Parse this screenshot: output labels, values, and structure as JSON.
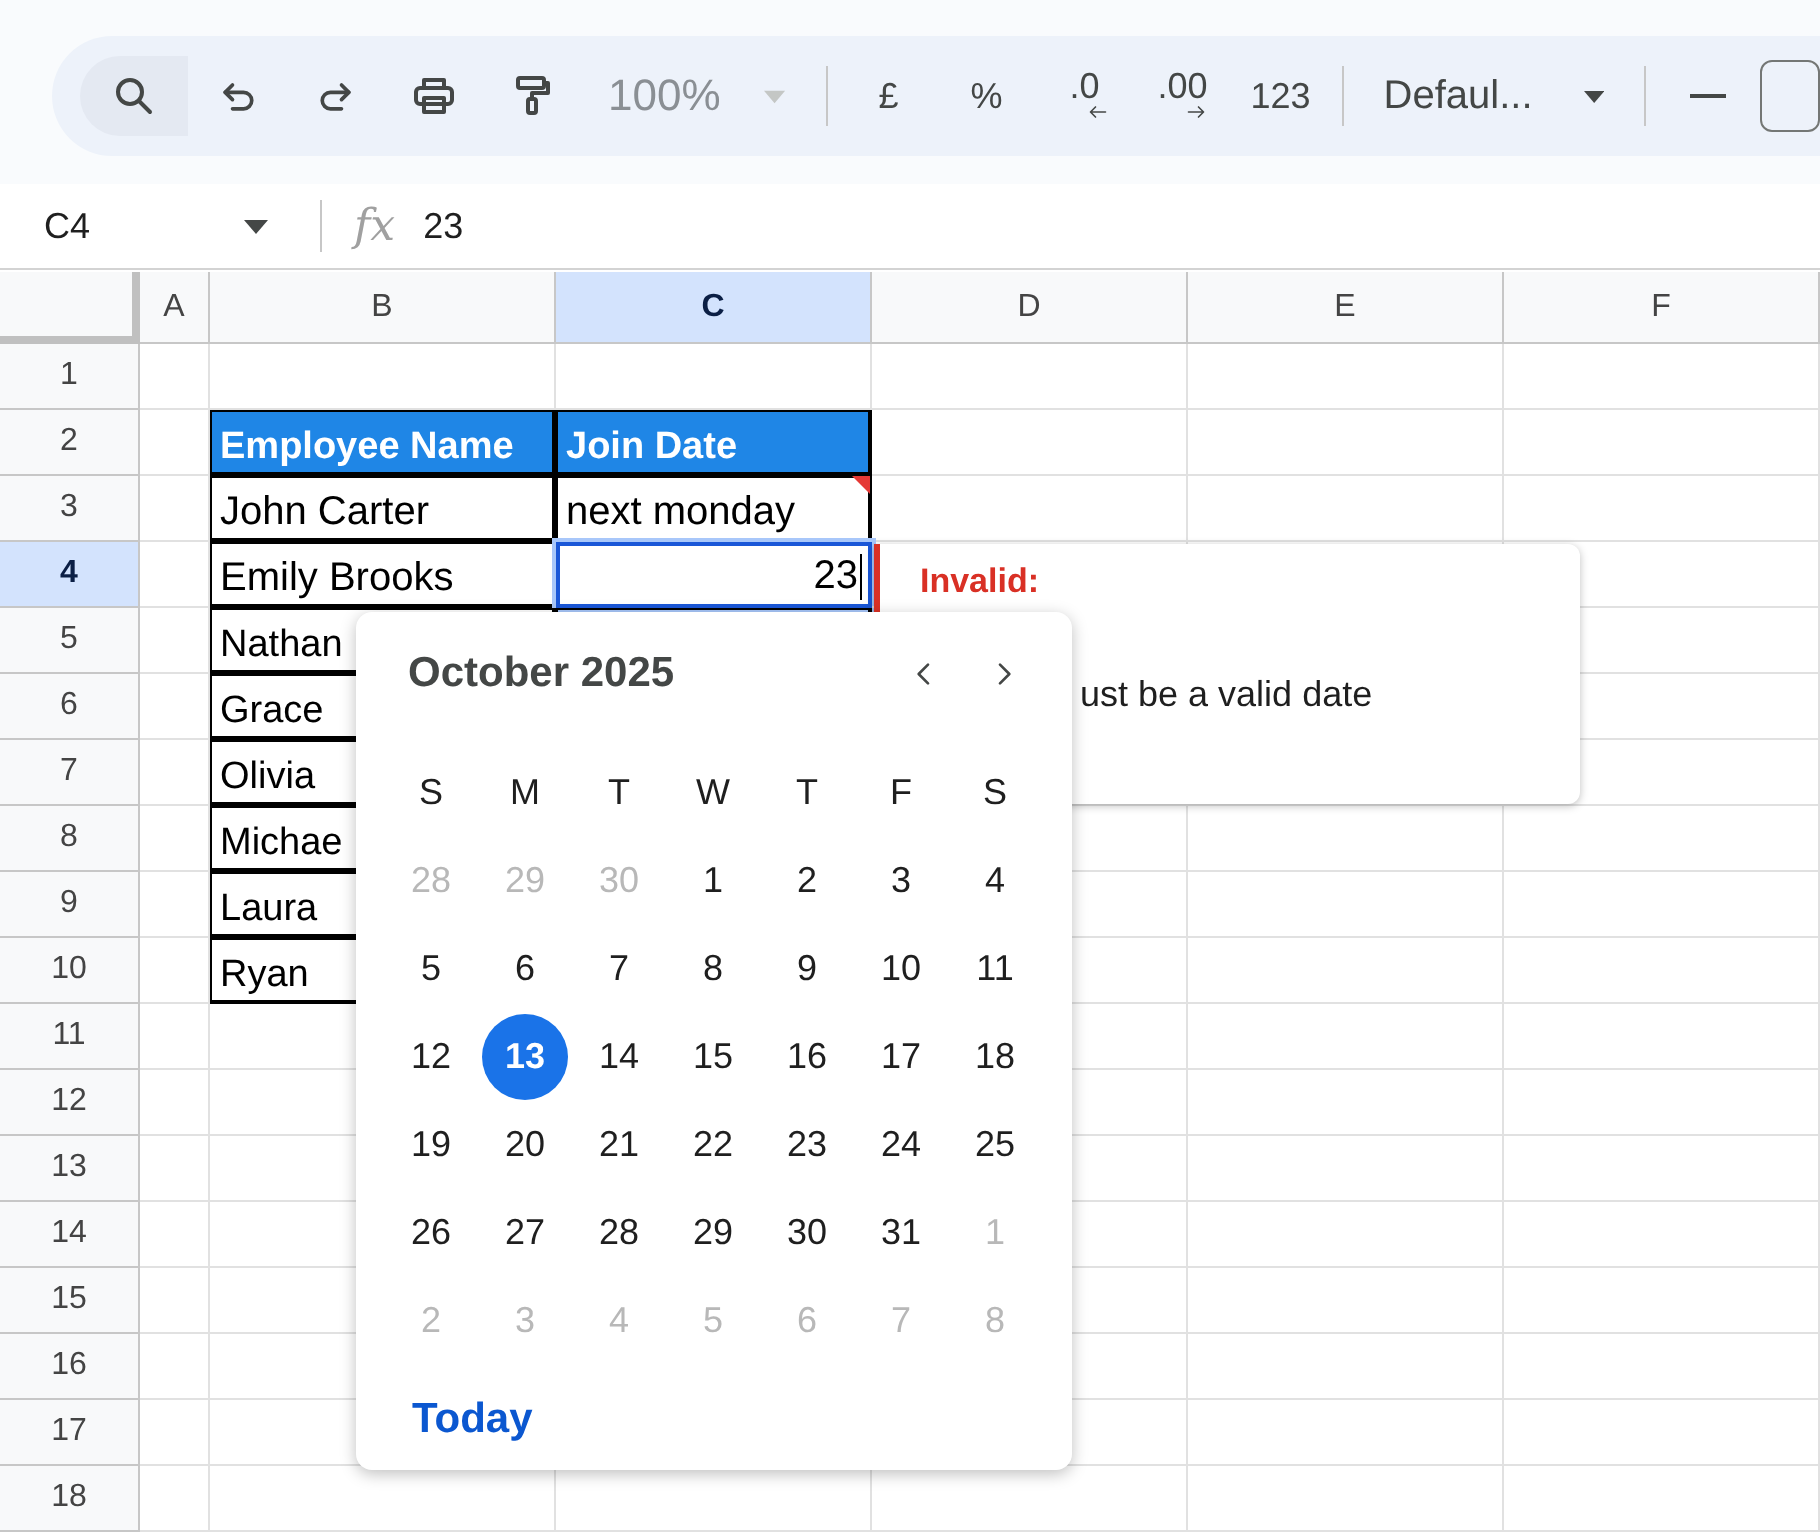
{
  "toolbar": {
    "items": [
      {
        "kind": "search"
      },
      {
        "kind": "undo"
      },
      {
        "kind": "redo"
      },
      {
        "kind": "print"
      },
      {
        "kind": "paint_format"
      },
      {
        "kind": "zoom",
        "label": "100%",
        "disabled": true
      },
      {
        "kind": "divider"
      },
      {
        "kind": "text",
        "label": "£"
      },
      {
        "kind": "text",
        "label": "%"
      },
      {
        "kind": "decimal_decrease",
        "label": ".0"
      },
      {
        "kind": "decimal_increase",
        "label": ".00"
      },
      {
        "kind": "text",
        "label": "123"
      },
      {
        "kind": "divider"
      },
      {
        "kind": "font",
        "label": "Defaul..."
      },
      {
        "kind": "divider"
      },
      {
        "kind": "minus"
      },
      {
        "kind": "size_box"
      }
    ]
  },
  "formula_bar": {
    "cell_ref": "C4",
    "fx": "fx",
    "value": "23"
  },
  "sheet": {
    "columns": [
      {
        "label": "A",
        "selected": false
      },
      {
        "label": "B",
        "selected": false
      },
      {
        "label": "C",
        "selected": true
      },
      {
        "label": "D",
        "selected": false
      },
      {
        "label": "E",
        "selected": false
      },
      {
        "label": "F",
        "selected": false
      }
    ],
    "rows": [
      {
        "label": "1",
        "selected": false
      },
      {
        "label": "2",
        "selected": false
      },
      {
        "label": "3",
        "selected": false
      },
      {
        "label": "4",
        "selected": true
      },
      {
        "label": "5",
        "selected": false
      },
      {
        "label": "6",
        "selected": false
      },
      {
        "label": "7",
        "selected": false
      },
      {
        "label": "8",
        "selected": false
      },
      {
        "label": "9",
        "selected": false
      },
      {
        "label": "10",
        "selected": false
      },
      {
        "label": "11",
        "selected": false
      },
      {
        "label": "12",
        "selected": false
      },
      {
        "label": "13",
        "selected": false
      },
      {
        "label": "14",
        "selected": false
      },
      {
        "label": "15",
        "selected": false
      },
      {
        "label": "16",
        "selected": false
      },
      {
        "label": "17",
        "selected": false
      },
      {
        "label": "18",
        "selected": false
      }
    ],
    "table": {
      "header": [
        "Employee Name",
        "Join Date"
      ],
      "rows": [
        {
          "name": "John Carter",
          "join_date": "next monday",
          "flagged": true,
          "editing": false
        },
        {
          "name": "Emily Brooks",
          "join_date": "23",
          "flagged": false,
          "editing": true
        },
        {
          "name": "Nathan"
        },
        {
          "name": "Grace"
        },
        {
          "name": "Olivia"
        },
        {
          "name": "Michae"
        },
        {
          "name": "Laura"
        },
        {
          "name": "Ryan"
        }
      ]
    }
  },
  "validation_tooltip": {
    "title": "Invalid:",
    "message": "ust be a valid date"
  },
  "date_picker": {
    "month": "October 2025",
    "weekdays": [
      "S",
      "M",
      "T",
      "W",
      "T",
      "F",
      "S"
    ],
    "weeks": [
      [
        {
          "day": "28",
          "outside": true,
          "selected": false
        },
        {
          "day": "29",
          "outside": true,
          "selected": false
        },
        {
          "day": "30",
          "outside": true,
          "selected": false
        },
        {
          "day": "1",
          "outside": false,
          "selected": false
        },
        {
          "day": "2",
          "outside": false,
          "selected": false
        },
        {
          "day": "3",
          "outside": false,
          "selected": false
        },
        {
          "day": "4",
          "outside": false,
          "selected": false
        }
      ],
      [
        {
          "day": "5",
          "outside": false,
          "selected": false
        },
        {
          "day": "6",
          "outside": false,
          "selected": false
        },
        {
          "day": "7",
          "outside": false,
          "selected": false
        },
        {
          "day": "8",
          "outside": false,
          "selected": false
        },
        {
          "day": "9",
          "outside": false,
          "selected": false
        },
        {
          "day": "10",
          "outside": false,
          "selected": false
        },
        {
          "day": "11",
          "outside": false,
          "selected": false
        }
      ],
      [
        {
          "day": "12",
          "outside": false,
          "selected": false
        },
        {
          "day": "13",
          "outside": false,
          "selected": true
        },
        {
          "day": "14",
          "outside": false,
          "selected": false
        },
        {
          "day": "15",
          "outside": false,
          "selected": false
        },
        {
          "day": "16",
          "outside": false,
          "selected": false
        },
        {
          "day": "17",
          "outside": false,
          "selected": false
        },
        {
          "day": "18",
          "outside": false,
          "selected": false
        }
      ],
      [
        {
          "day": "19",
          "outside": false,
          "selected": false
        },
        {
          "day": "20",
          "outside": false,
          "selected": false
        },
        {
          "day": "21",
          "outside": false,
          "selected": false
        },
        {
          "day": "22",
          "outside": false,
          "selected": false
        },
        {
          "day": "23",
          "outside": false,
          "selected": false
        },
        {
          "day": "24",
          "outside": false,
          "selected": false
        },
        {
          "day": "25",
          "outside": false,
          "selected": false
        }
      ],
      [
        {
          "day": "26",
          "outside": false,
          "selected": false
        },
        {
          "day": "27",
          "outside": false,
          "selected": false
        },
        {
          "day": "28",
          "outside": false,
          "selected": false
        },
        {
          "day": "29",
          "outside": false,
          "selected": false
        },
        {
          "day": "30",
          "outside": false,
          "selected": false
        },
        {
          "day": "31",
          "outside": false,
          "selected": false
        },
        {
          "day": "1",
          "outside": true,
          "selected": false
        }
      ],
      [
        {
          "day": "2",
          "outside": true,
          "selected": false
        },
        {
          "day": "3",
          "outside": true,
          "selected": false
        },
        {
          "day": "4",
          "outside": true,
          "selected": false
        },
        {
          "day": "5",
          "outside": true,
          "selected": false
        },
        {
          "day": "6",
          "outside": true,
          "selected": false
        },
        {
          "day": "7",
          "outside": true,
          "selected": false
        },
        {
          "day": "8",
          "outside": true,
          "selected": false
        }
      ]
    ],
    "today_label": "Today"
  }
}
